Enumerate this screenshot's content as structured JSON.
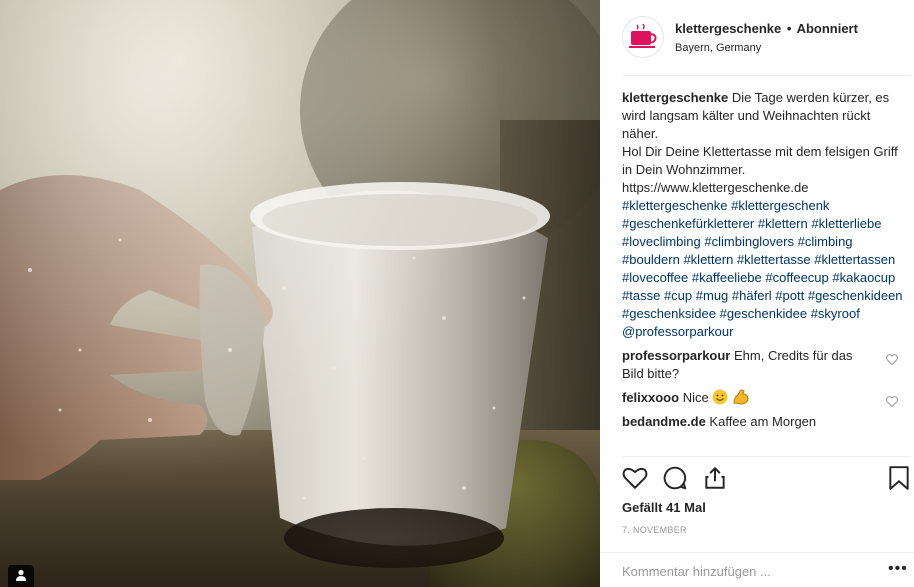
{
  "post": {
    "username": "klettergeschenke",
    "separator": "•",
    "follow_status": "Abonniert",
    "location": "Bayern, Germany",
    "avatar_icon": "cup-logo-icon",
    "caption": {
      "username": "klettergeschenke",
      "text_1": "Die Tage werden kürzer, es wird langsam kälter und Weihnachten rückt näher.",
      "text_2": "Hol Dir Deine Klettertasse mit dem felsigen Griff in Dein Wohnzimmer.",
      "url": "https://www.klettergeschenke.de",
      "hashtags": [
        "#klettergeschenke",
        "#klettergeschenk",
        "#geschenkefürkletterer",
        "#klettern",
        "#kletterliebe",
        "#loveclimbing",
        "#climbinglovers",
        "#climbing",
        "#bouldern",
        "#klettern",
        "#klettertasse",
        "#klettertassen",
        "#lovecoffee",
        "#kaffeeliebe",
        "#coffeecup",
        "#kakaocup",
        "#tasse",
        "#cup",
        "#mug",
        "#häferl",
        "#pott",
        "#geschenkideen",
        "#geschenksidee",
        "#geschenkidee",
        "#skyroof",
        "@professorparkour"
      ]
    },
    "comments": [
      {
        "username": "professorparkour",
        "text": "Ehm, Credits für das Bild bitte?"
      },
      {
        "username": "felixxooo",
        "text": "Nice"
      },
      {
        "username": "bedandme.de",
        "text": "Kaffee am Morgen"
      }
    ],
    "likes": "Gefällt 41 Mal",
    "date": "7. NOVEMBER",
    "comment_placeholder": "Kommentar hinzufügen ...",
    "more_label": "•••"
  },
  "colors": {
    "hashtag": "#003569",
    "text": "#262626",
    "muted": "#999999",
    "brand_logo": "#e0115f"
  }
}
